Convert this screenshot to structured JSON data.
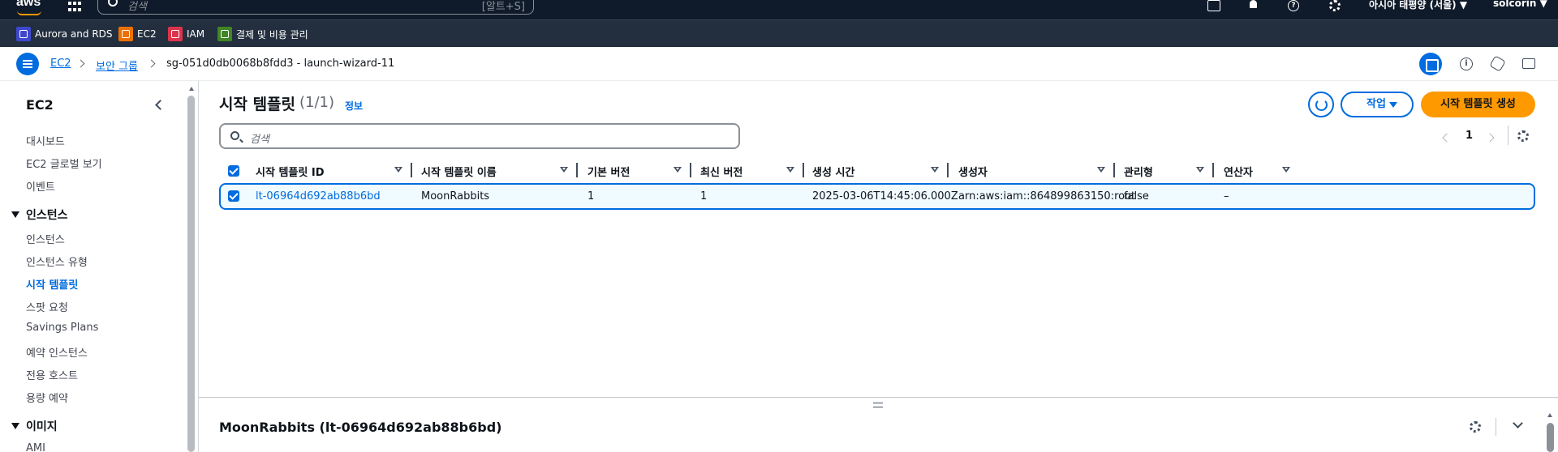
{
  "topnav": {
    "logo": "aws",
    "search_placeholder": "검색",
    "search_shortcut": "[알트+S]",
    "region": "아시아 태평양 (서울) ▼",
    "user": "solcorin ▼"
  },
  "favorites": [
    {
      "label": "Aurora and RDS",
      "icon": "rds-icon",
      "color": "#3f48cc"
    },
    {
      "label": "EC2",
      "icon": "ec2-icon",
      "color": "#ed7100"
    },
    {
      "label": "IAM",
      "icon": "iam-icon",
      "color": "#dd344c"
    },
    {
      "label": "결제 및 비용 관리",
      "icon": "billing-icon",
      "color": "#3f8624"
    }
  ],
  "breadcrumb": {
    "items": [
      "EC2",
      "보안 그룹",
      "sg-051d0db0068b8fdd3 - launch-wizard-11"
    ]
  },
  "sidebar": {
    "title": "EC2",
    "top_items": [
      "대시보드",
      "EC2 글로벌 보기",
      "이벤트"
    ],
    "sections": [
      {
        "title": "인스턴스",
        "items": [
          "인스턴스",
          "인스턴스 유형",
          "시작 템플릿",
          "스팟 요청",
          "Savings Plans",
          "예약 인스턴스",
          "전용 호스트",
          "용량 예약"
        ],
        "active": "시작 템플릿"
      },
      {
        "title": "이미지",
        "items": [
          "AMI"
        ]
      }
    ]
  },
  "main": {
    "title": "시작 템플릿",
    "count": "(1/1)",
    "info_link": "정보",
    "action_button": "작업",
    "create_button": "시작 템플릿 생성",
    "filter_placeholder": "검색",
    "page_number": "1",
    "columns": [
      "시작 템플릿 ID",
      "시작 템플릿 이름",
      "기본 버전",
      "최신 버전",
      "생성 시간",
      "생성자",
      "관리형",
      "연산자"
    ],
    "rows": [
      {
        "id": "lt-06964d692ab88b6bd",
        "name": "MoonRabbits",
        "default_version": "1",
        "latest_version": "1",
        "created": "2025-03-06T14:45:06.000Z",
        "created_by": "arn:aws:iam::864899863150:root",
        "managed": "false",
        "operator": "–"
      }
    ],
    "detail_title": "MoonRabbits (lt-06964d692ab88b6bd)"
  },
  "colors": {
    "accent": "#006ce0",
    "primary_button": "#ff9900",
    "topnav_bg": "#0f1b2a",
    "favbar_bg": "#232f3e"
  }
}
